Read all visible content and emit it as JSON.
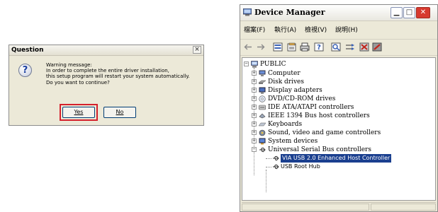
{
  "question_dialog": {
    "title": "Question",
    "close_glyph": "×",
    "message_lines": [
      "Warning message:",
      "In order to complete the entire driver installation,",
      "this setup program will restart your system automatically.",
      "Do you want to continue?"
    ],
    "yes_label": "Yes",
    "no_label": "No",
    "highlight_color": "#d4202b"
  },
  "device_manager": {
    "title": "Device Manager",
    "menu": [
      "檔案(F)",
      "執行(A)",
      "檢視(V)",
      "說明(H)"
    ],
    "toolbar_icons": [
      "back-icon",
      "forward-icon",
      "view-icon",
      "properties-icon",
      "print-icon",
      "help-icon",
      "scan-icon",
      "update-driver-icon",
      "uninstall-icon",
      "disable-icon"
    ],
    "tree": {
      "root": "PUBLIC",
      "categories": [
        {
          "label": "Computer",
          "icon": "computer-icon"
        },
        {
          "label": "Disk drives",
          "icon": "disk-drive-icon"
        },
        {
          "label": "Display adapters",
          "icon": "display-adapter-icon"
        },
        {
          "label": "DVD/CD-ROM drives",
          "icon": "cdrom-icon"
        },
        {
          "label": "IDE ATA/ATAPI controllers",
          "icon": "ide-controller-icon"
        },
        {
          "label": "IEEE 1394 Bus host controllers",
          "icon": "firewire-icon"
        },
        {
          "label": "Keyboards",
          "icon": "keyboard-icon"
        },
        {
          "label": "Sound, video and game controllers",
          "icon": "sound-icon"
        },
        {
          "label": "System devices",
          "icon": "system-device-icon"
        },
        {
          "label": "Universal Serial Bus controllers",
          "icon": "usb-icon"
        }
      ],
      "usb_children": [
        {
          "label": "VIA USB 2.0 Enhanced Host Controller",
          "selected": true
        },
        {
          "label": "USB Root Hub",
          "selected": false
        }
      ]
    },
    "accent_color": "#1a3f8f"
  }
}
